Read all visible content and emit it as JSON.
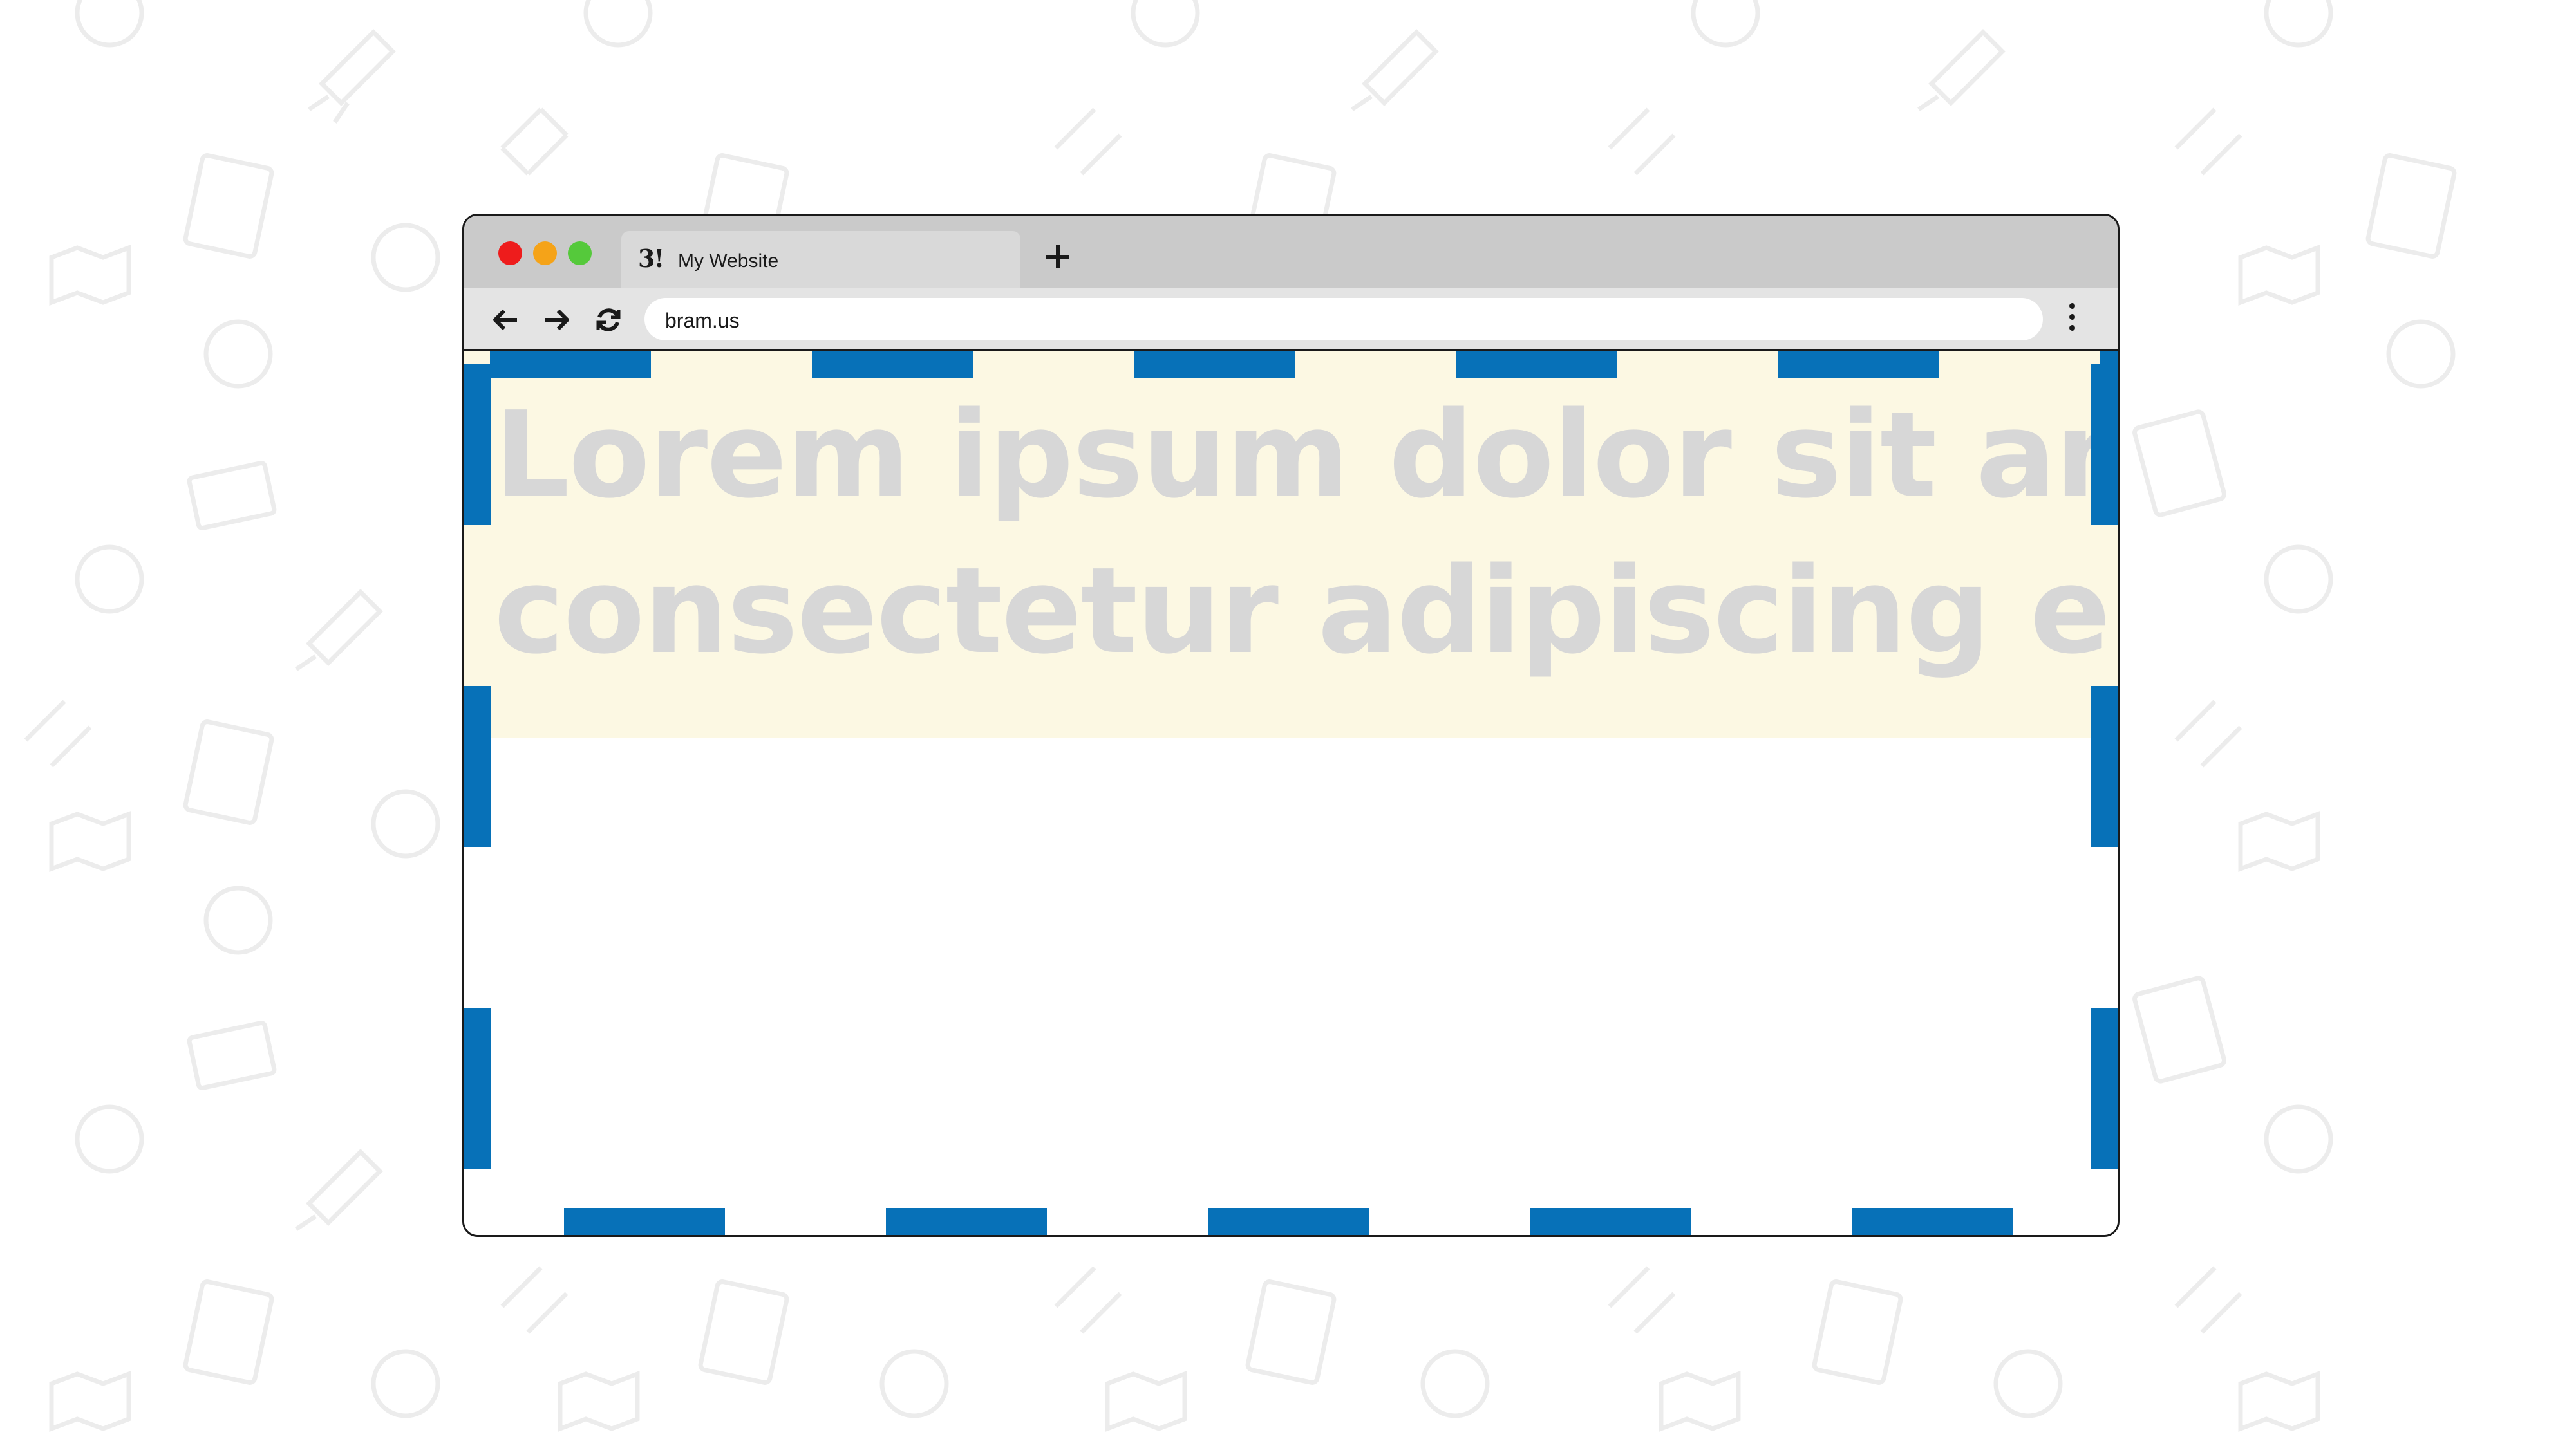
{
  "browser": {
    "tab": {
      "favicon": "3!",
      "title": "My Website"
    },
    "new_tab_icon": "plus-icon",
    "nav_icons": [
      "back-arrow-icon",
      "forward-arrow-icon",
      "reload-icon"
    ],
    "url": "bram.us",
    "menu_icon": "kebab-menu-icon",
    "traffic_lights": {
      "close": "#ee1c1c",
      "minimize": "#f5a318",
      "maximize": "#55c93b"
    }
  },
  "page": {
    "heading": "Lorem ipsum dolor sit amet, consectetur adipiscing elit.",
    "heading_line_1": "Lorem ipsum dolor sit amet,",
    "heading_line_2": "consectetur adipiscing elit.",
    "hero_background": "#fcf8e3",
    "heading_color": "#d7d7d7"
  },
  "viewport_outline": {
    "style": "dashed",
    "color": "#0771b8"
  }
}
